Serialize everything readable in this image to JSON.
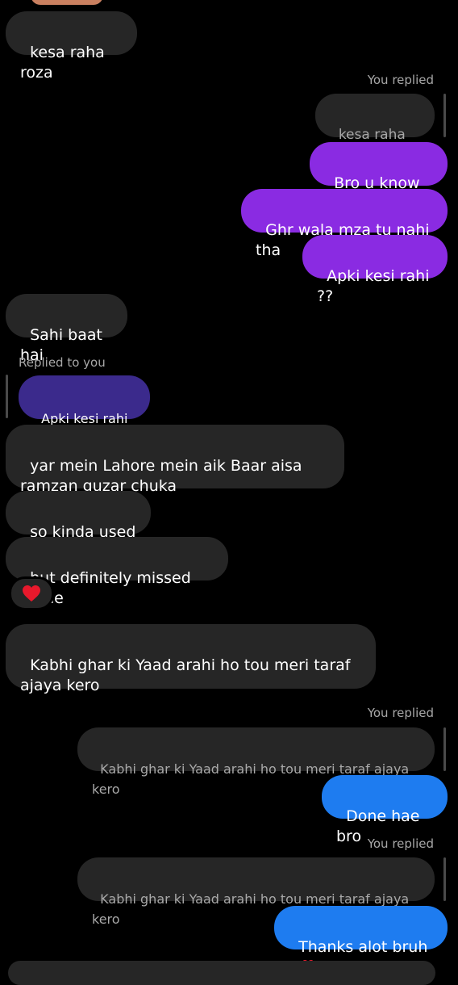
{
  "messages": {
    "m1": "kesa raha roza",
    "r1_label": "You replied",
    "r1_quote": "kesa raha roza",
    "m2": "Bro u know like",
    "m3": "Ghr wala mza tu nahi tha",
    "m4": "Apki kesi rahi ??",
    "m5": "Sahi baat hai",
    "r2_label": "Replied to you",
    "r2_quote": "Apki kesi rahi ??",
    "m6": "yar mein Lahore mein aik Baar aisa ramzan guzar chuka",
    "m7": "so kinda used to",
    "m8": "but definitely missed home",
    "m8_reaction": "heart",
    "m9": "Kabhi ghar ki Yaad arahi ho tou meri taraf ajaya kero",
    "r3_label": "You replied",
    "r3_quote": "Kabhi ghar ki Yaad arahi ho tou meri taraf ajaya kero",
    "m10": "Done hae bro",
    "r4_label": "You replied",
    "r4_quote": "Kabhi ghar ki Yaad arahi ho tou meri taraf ajaya kero",
    "m11": "Thanks alot bruh"
  },
  "colors": {
    "incoming_bubble": "#262626",
    "outgoing_purple": "#8a2be2",
    "outgoing_blue": "#1e7cf0",
    "quoted_purple": "#3b2a8c",
    "meta_text": "#a8a8a8",
    "heart": "#e8192c"
  }
}
